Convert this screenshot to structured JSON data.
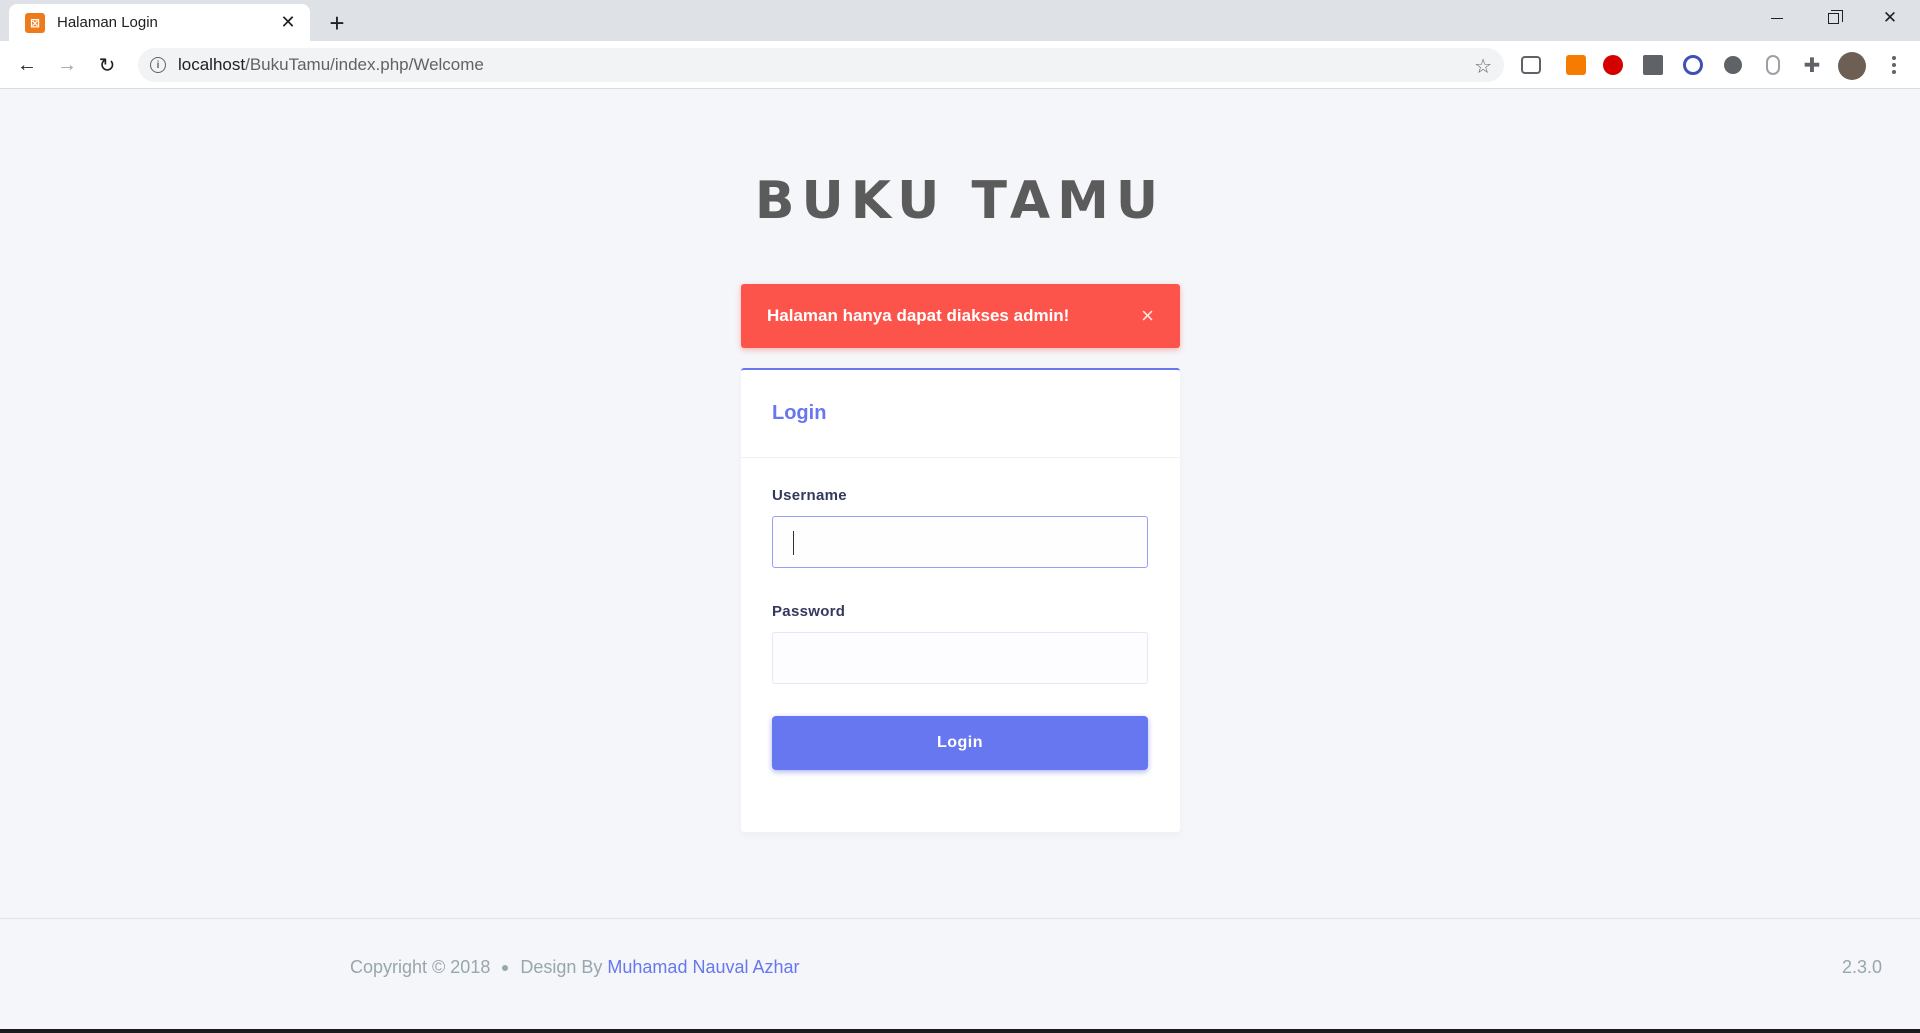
{
  "browser": {
    "tab_title": "Halaman Login",
    "url_host": "localhost",
    "url_path": "/BukuTamu/index.php/Welcome"
  },
  "page": {
    "brand": "BUKU TAMU",
    "alert": {
      "message": "Halaman hanya dapat diakses admin!",
      "close_glyph": "×"
    },
    "login_card": {
      "title": "Login",
      "username_label": "Username",
      "username_value": "",
      "password_label": "Password",
      "password_value": "",
      "submit_label": "Login"
    },
    "footer": {
      "copyright": "Copyright © 2018",
      "design_by": "Design By",
      "author": "Muhamad Nauval Azhar",
      "version": "2.3.0"
    }
  },
  "colors": {
    "primary": "#6777ef",
    "danger": "#fc544b",
    "background": "#f4f6f9"
  }
}
